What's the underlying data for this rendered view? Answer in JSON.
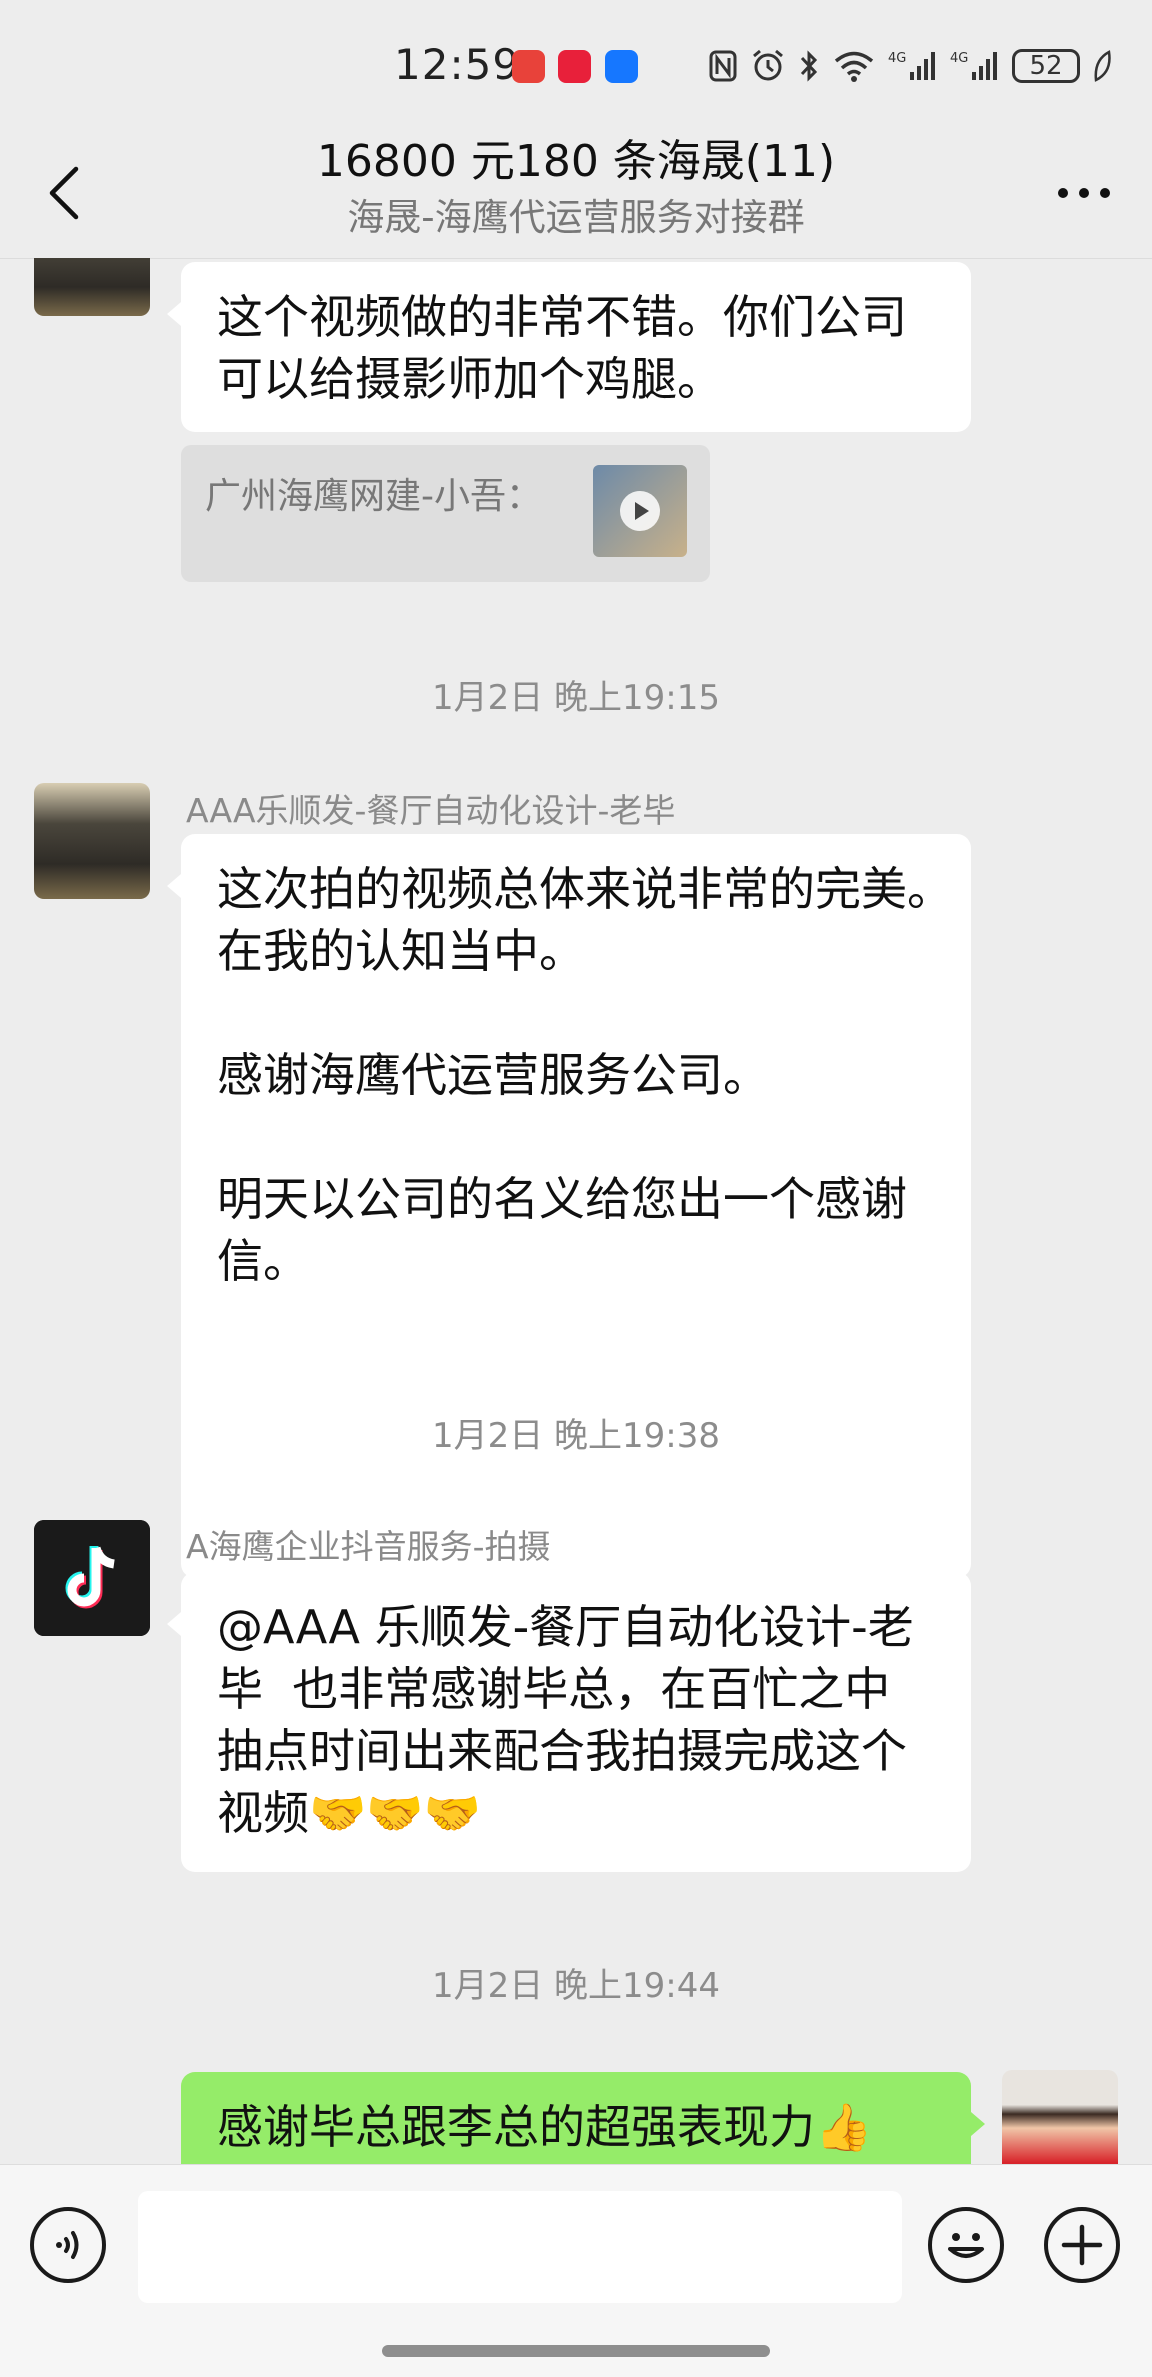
{
  "status_bar": {
    "time": "12:59",
    "battery": "52",
    "network": "4G",
    "apps": [
      {
        "name": "huawei-app-icon",
        "color": "#e8423a"
      },
      {
        "name": "xiaohongshu-app-icon",
        "color": "#e8203a"
      },
      {
        "name": "alipay-app-icon",
        "color": "#1677ff"
      }
    ]
  },
  "header": {
    "title": "16800 元180 条海晟(11)",
    "subtitle": "海晟-海鹰代运营服务对接群"
  },
  "messages": [
    {
      "text_lines": [
        "这个视频做的非常不错。你们公司",
        "可以给摄影师加个鸡腿。"
      ],
      "quote_text": "广州海鹰网建-小吾："
    },
    {
      "timestamp": "1月2日 晚上19:15"
    },
    {
      "sender": "AAA乐顺发-餐厅自动化设计-老毕",
      "text_lines": [
        "这次拍的视频总体来说非常的完美。",
        "在我的认知当中。",
        "",
        "感谢海鹰代运营服务公司。",
        "",
        "明天以公司的名义给您出一个感谢",
        "信。"
      ]
    },
    {
      "timestamp": "1月2日 晚上19:38"
    },
    {
      "sender": "A海鹰企业抖音服务-拍摄",
      "text_lines": [
        "@AAA 乐顺发-餐厅自动化设计-老",
        "毕  也非常感谢毕总，在百忙之中",
        "抽点时间出来配合我拍摄完成这个",
        "视频🤝🤝🤝"
      ]
    },
    {
      "timestamp": "1月2日 晚上19:44"
    },
    {
      "text_lines": [
        "感谢毕总跟李总的超强表现力👍"
      ]
    }
  ],
  "input": {
    "placeholder": ""
  },
  "colors": {
    "background": "#ededed",
    "my_bubble": "#95ec69",
    "other_bubble": "#ffffff"
  }
}
